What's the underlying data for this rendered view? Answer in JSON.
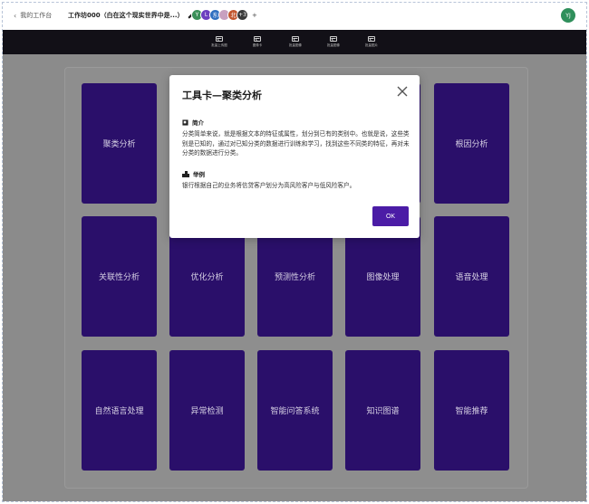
{
  "header": {
    "back_label": "我的工作台",
    "workbench_title": "工作坊000（白在这个现实世界中是...）",
    "collaborators": [
      {
        "initial": "Y",
        "color": "#3a8f58"
      },
      {
        "initial": "L",
        "color": "#6b3fbf"
      },
      {
        "initial": "东",
        "color": "#2f6fc0"
      },
      {
        "initial": "",
        "color": "#c8a0c0"
      },
      {
        "initial": "北",
        "color": "#c2562e"
      },
      {
        "initial": "+3",
        "color": "#3a3a3a"
      }
    ],
    "user_initials": "YJ"
  },
  "toolbar": {
    "tools": [
      {
        "label": "批量上传图",
        "icon": "image-icon"
      },
      {
        "label": "图像卡",
        "icon": "image-icon"
      },
      {
        "label": "批量图像",
        "icon": "image-icon"
      },
      {
        "label": "批量图像",
        "icon": "image-icon"
      },
      {
        "label": "批量图片",
        "icon": "image-icon"
      }
    ]
  },
  "cards": [
    {
      "label": "聚类分析"
    },
    {
      "label": ""
    },
    {
      "label": ""
    },
    {
      "label": ""
    },
    {
      "label": "根因分析"
    },
    {
      "label": "关联性分析"
    },
    {
      "label": "优化分析"
    },
    {
      "label": "预测性分析"
    },
    {
      "label": "图像处理"
    },
    {
      "label": "语音处理"
    },
    {
      "label": "自然语言处理"
    },
    {
      "label": "异常检测"
    },
    {
      "label": "智能问答系统"
    },
    {
      "label": "知识图谱"
    },
    {
      "label": "智能推荐"
    }
  ],
  "modal": {
    "title": "工具卡—聚类分析",
    "intro_heading": "简介",
    "intro_text": "分类简单来说，就是根据文本的特征或属性，划分到已有的类别中。也就是说，这些类别是已知的，通过对已知分类的数据进行训练和学习，找到这些不同类的特征，再对未分类的数据进行分类。",
    "example_heading": "举例",
    "example_text": "银行根据自己的业务将信贷客户划分为高风险客户与低风险客户。",
    "ok_label": "OK"
  },
  "colors": {
    "card": "#2a0f6a",
    "ok_button": "#4b1ca6",
    "toolbar": "#121017"
  }
}
